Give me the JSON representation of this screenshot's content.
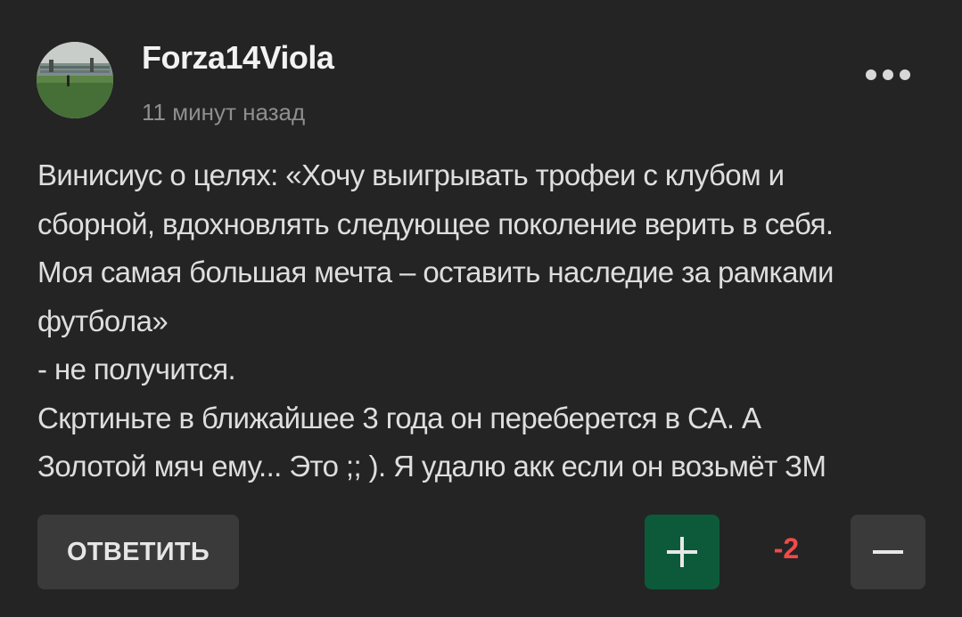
{
  "comment": {
    "author": "Forza14Viola",
    "time": "11 минут назад",
    "text_lines": [
      "Винисиус о целях: «Хочу выигрывать трофеи с клубом и",
      "сборной, вдохновлять следующее поколение верить в себя.",
      "Моя самая большая мечта – оставить наследие за рамками",
      "футбола»",
      "- не получится.",
      "Скртиньте в ближайшее 3 года он переберется в СА. А",
      "Золотой мяч ему... Это ;; ). Я удалю акк если он возьмёт ЗМ"
    ],
    "more_icon": "ellipsis-horizontal",
    "avatar_description_icon": "avatar-stadium-photo"
  },
  "actions": {
    "reply_label": "ОТВЕТИТЬ",
    "upvote_icon": "plus-icon",
    "downvote_icon": "minus-icon",
    "score": "-2"
  },
  "colors": {
    "background": "#242424",
    "upvote_bg": "#0c5a3a",
    "button_bg": "#3a3a3a",
    "score_negative": "#f04a4a",
    "timestamp": "#8f8f8f"
  }
}
